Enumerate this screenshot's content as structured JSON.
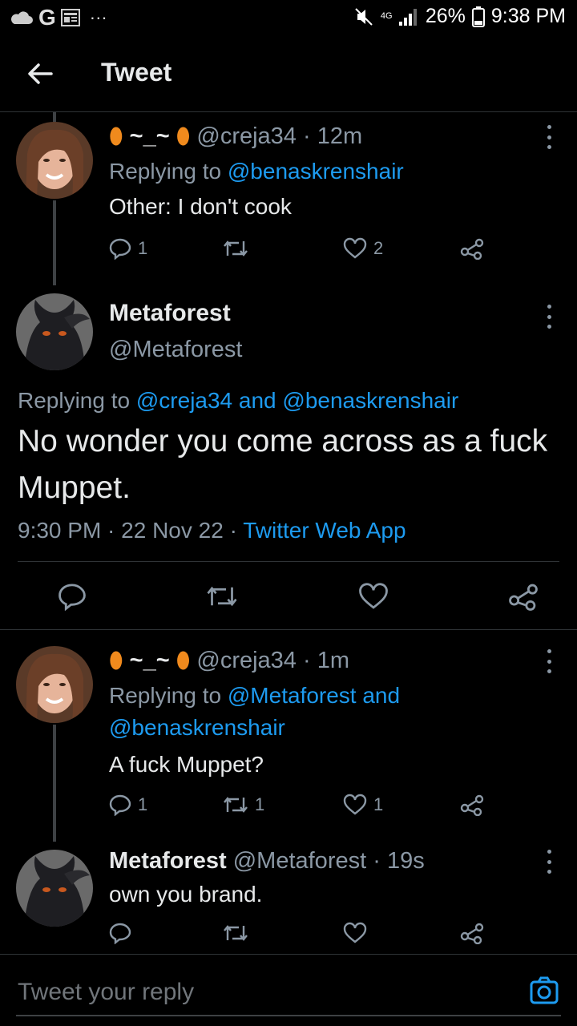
{
  "status_bar": {
    "left_icons": [
      "cloud-icon",
      "google-icon",
      "news-icon",
      "more-dots-icon"
    ],
    "google_letter": "G",
    "dots": "···",
    "battery": "26%",
    "time": "9:38 PM",
    "network": "4G"
  },
  "header": {
    "title": "Tweet"
  },
  "tweets": [
    {
      "display_name": "~_~",
      "handle": "@creja34",
      "time": "· 12m",
      "replying_prefix": "Replying to",
      "replying_to": "@benaskrenshair",
      "text": "Other: I don't cook",
      "replies": "1",
      "retweets": "",
      "likes": "2"
    },
    {
      "display_name": "Metaforest",
      "handle": "@Metaforest",
      "replying_prefix": "Replying to",
      "replying_to": "@creja34 and @benaskrenshair",
      "text": "No wonder you come across as a fuck Muppet.",
      "timestamp": "9:30 PM · 22 Nov 22 ·",
      "client": "Twitter Web App"
    },
    {
      "display_name": "~_~",
      "handle": "@creja34",
      "time": "· 1m",
      "replying_prefix": "Replying to",
      "replying_to_line1": "@Metaforest and",
      "replying_to_line2": "@benaskrenshair",
      "text": "A fuck Muppet?",
      "replies": "1",
      "retweets": "1",
      "likes": "1"
    },
    {
      "display_name": "Metaforest",
      "handle": "@Metaforest",
      "time": "· 19s",
      "text": "own you brand.",
      "replies": "",
      "retweets": "",
      "likes": ""
    }
  ],
  "reply_bar": {
    "placeholder": "Tweet your reply"
  },
  "colors": {
    "accent": "#1d9bf0",
    "background": "#000000",
    "secondary_text": "#8b98a5"
  }
}
